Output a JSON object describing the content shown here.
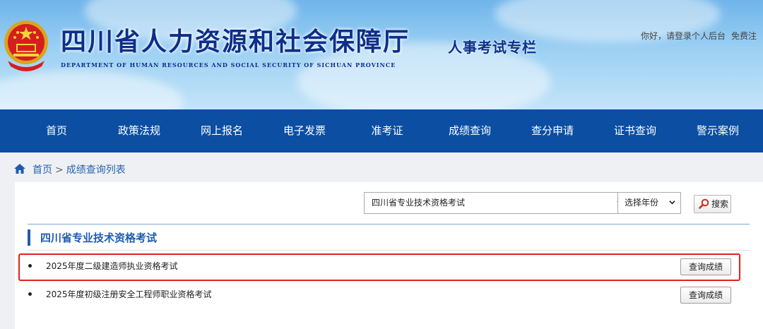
{
  "header": {
    "site_title": "四川省人力资源和社会保障厅",
    "site_subtitle": "DEPARTMENT OF HUMAN RESOURCES AND SOCIAL SECURITY OF SICHUAN PROVINCE",
    "section_title": "人事考试专栏",
    "user_links": [
      "你好，请登录个人后台",
      "免费注"
    ]
  },
  "nav": {
    "items": [
      "首页",
      "政策法规",
      "网上报名",
      "电子发票",
      "准考证",
      "成绩查询",
      "查分申请",
      "证书查询",
      "警示案例"
    ]
  },
  "breadcrumb": {
    "home": "首页",
    "separator": ">",
    "current": "成绩查询列表"
  },
  "filters": {
    "exam_select_value": "四川省专业技术资格考试",
    "year_select_value": "选择年份",
    "search_label": "搜索"
  },
  "category": {
    "title": "四川省专业技术资格考试"
  },
  "exams": [
    {
      "title": "2025年度二级建造师执业资格考试",
      "action": "查询成绩",
      "highlighted": true
    },
    {
      "title": "2025年度初级注册安全工程师职业资格考试",
      "action": "查询成绩",
      "highlighted": false
    }
  ],
  "colors": {
    "nav_bg": "#0b4ea2",
    "title_blue": "#0d2f8a",
    "link_blue": "#2a62b0",
    "highlight_red": "#e02020"
  }
}
